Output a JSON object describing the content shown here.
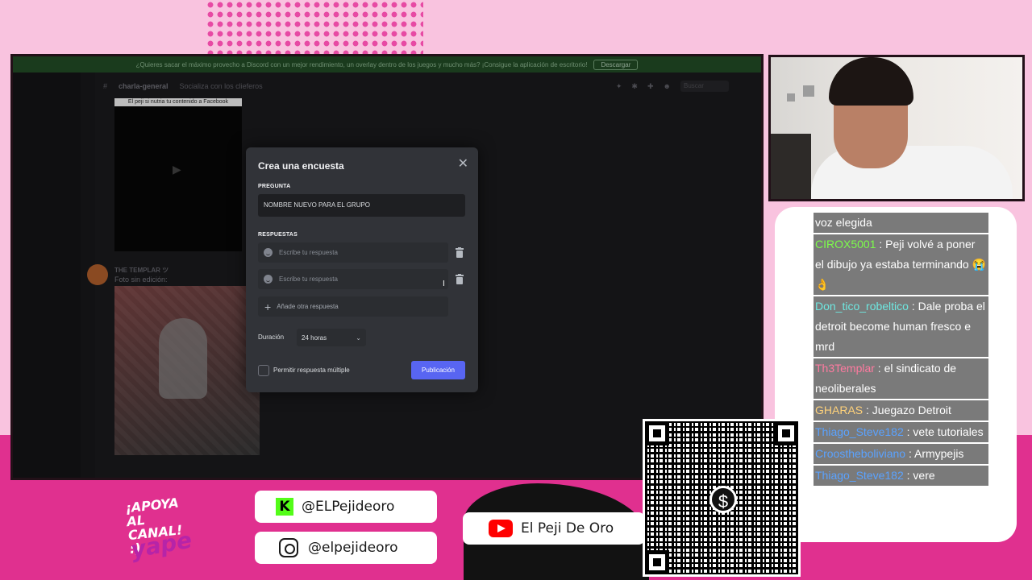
{
  "discord": {
    "banner_text": "¿Quieres sacar el máximo provecho a Discord con un mejor rendimiento, un overlay dentro de los juegos y mucho más? ¡Consigue la aplicación de escritorio!",
    "banner_button": "Descargar",
    "channel_name": "charla-general",
    "channel_topic": "Socializa con los clieferos",
    "search_placeholder": "Buscar",
    "video_caption": "El peji si nutria tu contenido a Facebook",
    "message_author": "THE TEMPLAR ツ",
    "message_text": "Foto sin edición:"
  },
  "poll_modal": {
    "title": "Crea una encuesta",
    "question_label": "PREGUNTA",
    "question_value": "NOMBRE NUEVO PARA EL GRUPO",
    "answers_label": "RESPUESTAS",
    "answers": [
      {
        "placeholder": "Escribe tu respuesta"
      },
      {
        "placeholder": "Escribe tu respuesta"
      }
    ],
    "add_answer_label": "Añade otra respuesta",
    "duration_label": "Duración",
    "duration_value": "24 horas",
    "multiple_label": "Permitir respuesta múltiple",
    "publish_label": "Publicación"
  },
  "chat": {
    "messages": [
      {
        "user": "",
        "text": "voz elegida",
        "color": "#ffffff"
      },
      {
        "user": "CIROX5001",
        "text": " : Peji volvé a poner el dibujo ya estaba terminando 😭👌",
        "color": "#7cfc4a"
      },
      {
        "user": "Don_tico_robeltico",
        "text": " : Dale proba el detroit become human fresco e mrd",
        "color": "#6ee7e0"
      },
      {
        "user": "Th3Templar",
        "text": " : el sindicato de neoliberales",
        "color": "#ff7aa0"
      },
      {
        "user": "GHARAS",
        "text": " : Juegazo Detroit",
        "color": "#ffd27a"
      },
      {
        "user": "Thiago_Steve182",
        "text": " : vete tutoriales",
        "color": "#5aa2ff"
      },
      {
        "user": "Croostheboliviano",
        "text": " : Armypejis",
        "color": "#5aa2ff"
      },
      {
        "user": "Thiago_Steve182",
        "text": " : vere",
        "color": "#5aa2ff"
      }
    ]
  },
  "socials": {
    "kick": "@ELPejideoro",
    "instagram": "@elpejideoro",
    "youtube": "El Peji De Oro"
  },
  "promo": {
    "support_text": "¡APOYA AL CANAL! :)",
    "yape_logo": "yape"
  },
  "colors": {
    "background_pink": "#f9c3df",
    "band_magenta": "#e0308f",
    "discord_blurple": "#5865f2"
  }
}
